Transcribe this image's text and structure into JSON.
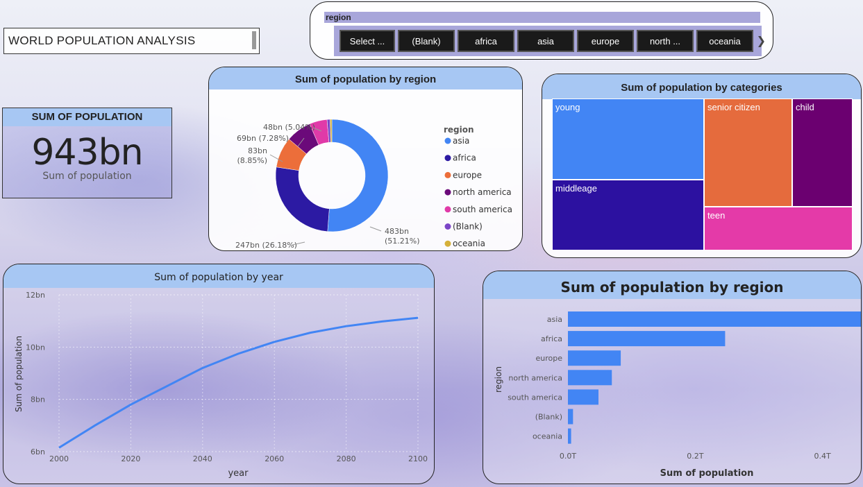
{
  "page_title": "WORLD POPULATION ANALYSIS",
  "slicer": {
    "header": "region",
    "chips": [
      "Select ...",
      "(Blank)",
      "africa",
      "asia",
      "europe",
      "north ...",
      "oceania"
    ],
    "next_icon": "chevron-right-icon"
  },
  "kpi": {
    "header": "SUM OF POPULATION",
    "value": "943bn",
    "label": "Sum of population"
  },
  "colors": {
    "asia": "#4285f4",
    "africa": "#2c1aa3",
    "europe": "#ec6e3a",
    "north_america": "#6b0a7a",
    "south_america": "#e03aa8",
    "blank": "#7b45c7",
    "oceania": "#d5b03a",
    "young": "#4285f4",
    "middleage": "#2c11a0",
    "senior": "#e56b3d",
    "child": "#6b0070",
    "teen": "#e43aa8",
    "line": "#4285f4",
    "header": "#a7c7f3"
  },
  "chart_data": [
    {
      "type": "pie",
      "title": "Sum of population by region",
      "legend_title": "region",
      "legend_position": "right",
      "categories": [
        "asia",
        "africa",
        "europe",
        "north america",
        "south america",
        "(Blank)",
        "oceania"
      ],
      "values": [
        483,
        247,
        83,
        69,
        48,
        8,
        5
      ],
      "data_labels": [
        "483bn\n(51.21%)",
        "247bn (26.18%)",
        "83bn\n(8.85%)",
        "69bn (7.28%)",
        "48bn (5.04%)",
        "",
        ""
      ]
    },
    {
      "type": "treemap",
      "title": "Sum of population by categories",
      "categories": [
        "young",
        "middleage",
        "senior citizen",
        "child",
        "teen"
      ]
    },
    {
      "type": "line",
      "title": "Sum of population by year",
      "xlabel": "year",
      "ylabel": "Sum of population",
      "x_ticks": [
        "2000",
        "2020",
        "2040",
        "2060",
        "2080",
        "2100"
      ],
      "y_ticks": [
        "6bn",
        "8bn",
        "10bn",
        "12bn"
      ],
      "xlim": [
        2000,
        2100
      ],
      "ylim": [
        6,
        12
      ],
      "grid": true,
      "x": [
        2000,
        2010,
        2020,
        2030,
        2040,
        2050,
        2060,
        2070,
        2080,
        2090,
        2100
      ],
      "values": [
        6.15,
        7.0,
        7.8,
        8.5,
        9.2,
        9.75,
        10.2,
        10.55,
        10.8,
        10.98,
        11.12
      ]
    },
    {
      "type": "bar",
      "orientation": "horizontal",
      "title": "Sum of population by region",
      "xlabel": "Sum of population",
      "ylabel": "region",
      "categories": [
        "asia",
        "africa",
        "europe",
        "north america",
        "south america",
        "(Blank)",
        "oceania"
      ],
      "values": [
        483,
        247,
        83,
        69,
        48,
        8,
        5
      ],
      "x_ticks": [
        "0.0T",
        "0.2T",
        "0.4T"
      ],
      "xlim": [
        0,
        0.48
      ]
    }
  ]
}
